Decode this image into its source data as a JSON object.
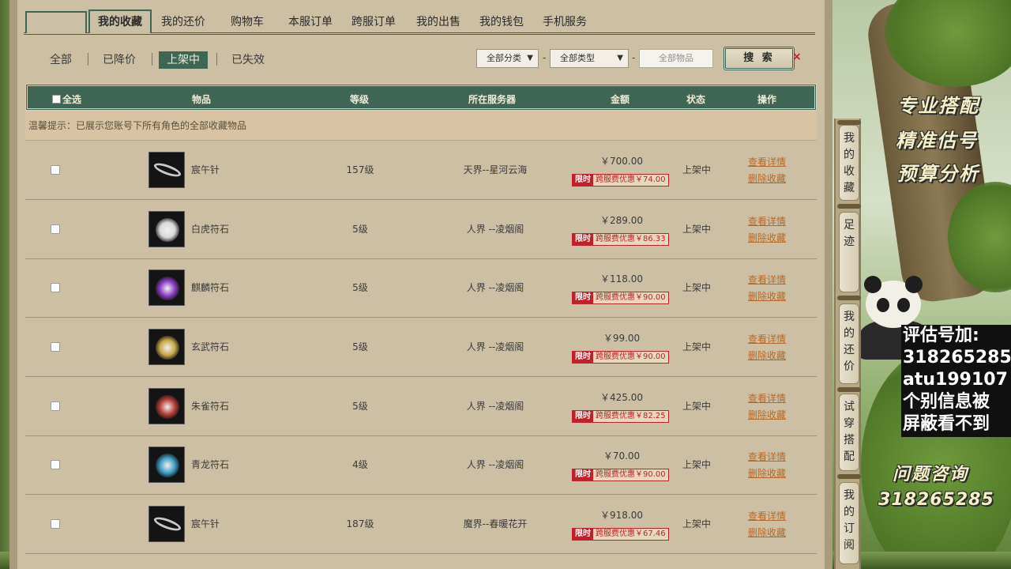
{
  "tabs": [
    "我的收藏",
    "我的还价",
    "购物车",
    "本服订单",
    "跨服订单",
    "我的出售",
    "我的钱包",
    "手机服务"
  ],
  "active_tab": "我的收藏",
  "filters": [
    "全部",
    "已降价",
    "上架中",
    "已失效"
  ],
  "active_filter": "上架中",
  "search": {
    "category": "全部分类",
    "type": "全部类型",
    "item_placeholder": "全部物品",
    "button": "搜 索",
    "close": "×"
  },
  "table": {
    "headers": {
      "select_all": "全选",
      "item": "物品",
      "level": "等级",
      "server": "所在服务器",
      "amount": "金额",
      "status": "状态",
      "action": "操作"
    },
    "notice": "温馨提示：已展示您账号下所有角色的全部收藏物品",
    "promo_tag": "限时",
    "view_label": "查看详情",
    "remove_label": "删除收藏",
    "rows": [
      {
        "name": "宸午针",
        "level": "157级",
        "server": "天界--星河云海",
        "price": "￥700.00",
        "promo": "跨服费优惠￥74.00",
        "status": "上架中",
        "icon": "needle-icon",
        "color": ""
      },
      {
        "name": "白虎符石",
        "level": "5级",
        "server": "人界 --凌烟阁",
        "price": "￥289.00",
        "promo": "跨服费优惠￥86.33",
        "status": "上架中",
        "icon": "white-tiger-rune-icon",
        "color": "#d9d9d9"
      },
      {
        "name": "麒麟符石",
        "level": "5级",
        "server": "人界 --凌烟阁",
        "price": "￥118.00",
        "promo": "跨服费优惠￥90.00",
        "status": "上架中",
        "icon": "qilin-rune-icon",
        "color": "#8a3fc4"
      },
      {
        "name": "玄武符石",
        "level": "5级",
        "server": "人界 --凌烟阁",
        "price": "￥99.00",
        "promo": "跨服费优惠￥90.00",
        "status": "上架中",
        "icon": "black-tortoise-rune-icon",
        "color": "#c9a74a"
      },
      {
        "name": "朱雀符石",
        "level": "5级",
        "server": "人界 --凌烟阁",
        "price": "￥425.00",
        "promo": "跨服费优惠￥82.25",
        "status": "上架中",
        "icon": "vermilion-bird-rune-icon",
        "color": "#b8403a"
      },
      {
        "name": "青龙符石",
        "level": "4级",
        "server": "人界 --凌烟阁",
        "price": "￥70.00",
        "promo": "跨服费优惠￥90.00",
        "status": "上架中",
        "icon": "azure-dragon-rune-icon",
        "color": "#3f9ec4"
      },
      {
        "name": "宸午针",
        "level": "187级",
        "server": "魔界--春暖花开",
        "price": "￥918.00",
        "promo": "跨服费优惠￥67.46",
        "status": "上架中",
        "icon": "needle-icon",
        "color": ""
      }
    ]
  },
  "sidebar_tabs": [
    "我的收藏",
    "足迹",
    "我的还价",
    "试穿搭配",
    "我的订阅"
  ],
  "overlay": {
    "slogan1": "专业搭配",
    "slogan2": "精准估号",
    "slogan3": "预算分析",
    "box_line1": "评估号加:",
    "box_line2": "318265285",
    "box_line3": "atu199107",
    "box_line4": "个别信息被",
    "box_line5": "屏蔽看不到",
    "consult": "问题咨询",
    "consult_number": "318265285"
  }
}
